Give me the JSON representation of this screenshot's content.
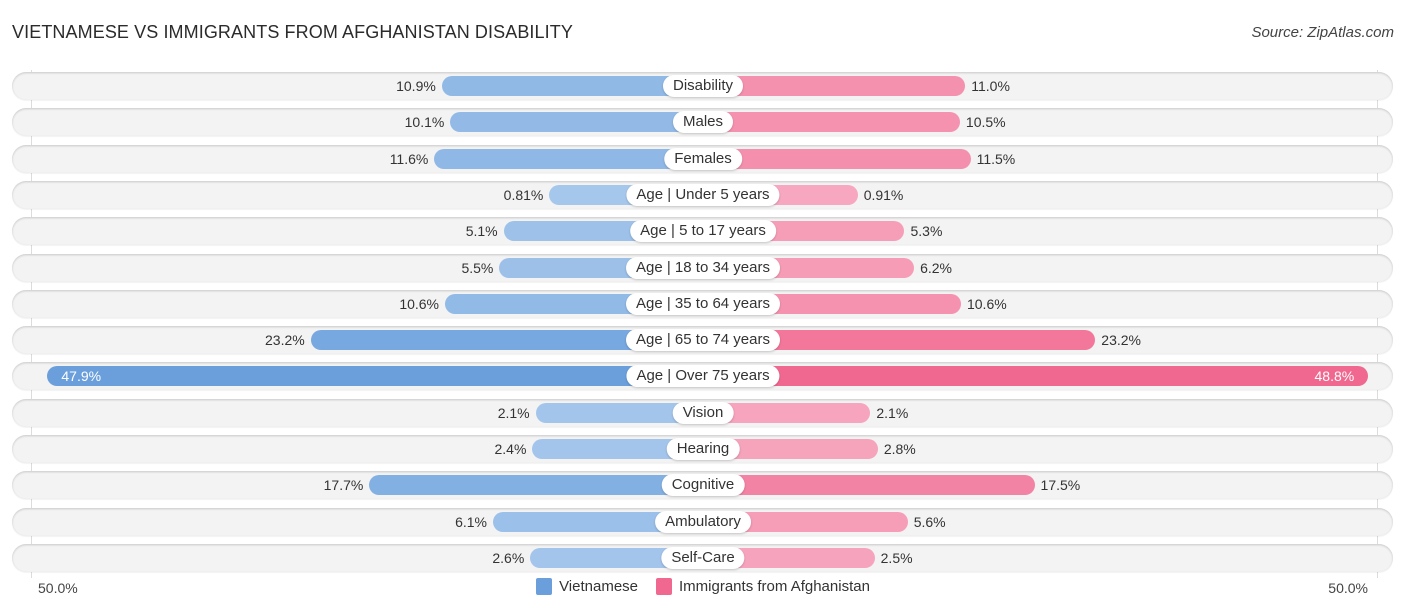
{
  "header": {
    "title": "VIETNAMESE VS IMMIGRANTS FROM AFGHANISTAN DISABILITY",
    "source": "Source: ZipAtlas.com"
  },
  "colors": {
    "vietnamese": "#6a9fdc",
    "vietnamese_light": "#a8c8ec",
    "afghanistan": "#f06890",
    "afghanistan_light": "#f7a9c1"
  },
  "axis": {
    "left_label": "50.0%",
    "right_label": "50.0%"
  },
  "legend": [
    {
      "label": "Vietnamese",
      "key": "vietnamese"
    },
    {
      "label": "Immigrants from Afghanistan",
      "key": "afghanistan"
    }
  ],
  "chart_data": {
    "type": "bar",
    "orientation": "horizontal-diverging",
    "title": "VIETNAMESE VS IMMIGRANTS FROM AFGHANISTAN DISABILITY",
    "xlim": [
      0,
      50
    ],
    "x_unit": "%",
    "legend_position": "bottom",
    "categories": [
      "Disability",
      "Males",
      "Females",
      "Age | Under 5 years",
      "Age | 5 to 17 years",
      "Age | 18 to 34 years",
      "Age | 35 to 64 years",
      "Age | 65 to 74 years",
      "Age | Over 75 years",
      "Vision",
      "Hearing",
      "Cognitive",
      "Ambulatory",
      "Self-Care"
    ],
    "series": [
      {
        "name": "Vietnamese",
        "side": "left",
        "values": [
          10.9,
          10.1,
          11.6,
          0.81,
          5.1,
          5.5,
          10.6,
          23.2,
          47.9,
          2.1,
          2.4,
          17.7,
          6.1,
          2.6
        ],
        "labels": [
          "10.9%",
          "10.1%",
          "11.6%",
          "0.81%",
          "5.1%",
          "5.5%",
          "10.6%",
          "23.2%",
          "47.9%",
          "2.1%",
          "2.4%",
          "17.7%",
          "6.1%",
          "2.6%"
        ]
      },
      {
        "name": "Immigrants from Afghanistan",
        "side": "right",
        "values": [
          11.0,
          10.5,
          11.5,
          0.91,
          5.3,
          6.2,
          10.6,
          23.2,
          48.8,
          2.1,
          2.8,
          17.5,
          5.6,
          2.5
        ],
        "labels": [
          "11.0%",
          "10.5%",
          "11.5%",
          "0.91%",
          "5.3%",
          "6.2%",
          "10.6%",
          "23.2%",
          "48.8%",
          "2.1%",
          "2.8%",
          "17.5%",
          "5.6%",
          "2.5%"
        ]
      }
    ]
  }
}
